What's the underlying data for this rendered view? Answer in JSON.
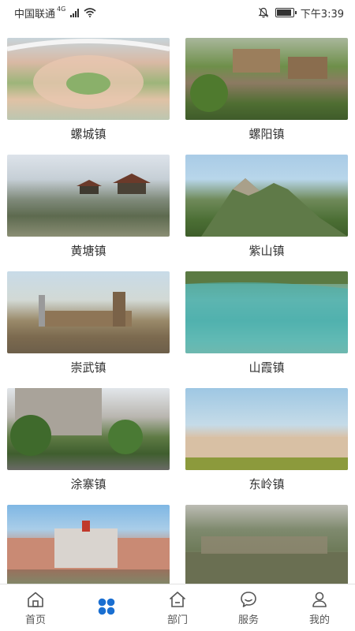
{
  "status_bar": {
    "carrier": "中国联通",
    "network": "4G",
    "time": "下午3:39"
  },
  "towns": [
    {
      "name": "螺城镇",
      "image_icon": "plaza-photo"
    },
    {
      "name": "螺阳镇",
      "image_icon": "village-photo"
    },
    {
      "name": "黄塘镇",
      "image_icon": "lake-pavilion-photo"
    },
    {
      "name": "紫山镇",
      "image_icon": "mountain-photo"
    },
    {
      "name": "崇武镇",
      "image_icon": "ancient-wall-photo"
    },
    {
      "name": "山霞镇",
      "image_icon": "turquoise-lake-photo"
    },
    {
      "name": "涂寨镇",
      "image_icon": "street-photo"
    },
    {
      "name": "东岭镇",
      "image_icon": "houses-photo"
    },
    {
      "name": "",
      "image_icon": "school-gate-photo"
    },
    {
      "name": "",
      "image_icon": "aerial-town-photo"
    }
  ],
  "tabbar": {
    "tabs": [
      {
        "label": "首页",
        "icon": "home-outline-icon",
        "active": false
      },
      {
        "label": "",
        "icon": "four-dots-icon",
        "active": true
      },
      {
        "label": "部门",
        "icon": "house-icon",
        "active": false
      },
      {
        "label": "服务",
        "icon": "chat-bubble-icon",
        "active": false
      },
      {
        "label": "我的",
        "icon": "person-icon",
        "active": false
      }
    ]
  },
  "colors": {
    "accent": "#1a6fd1",
    "text": "#333333",
    "divider": "#e2e2e2"
  }
}
